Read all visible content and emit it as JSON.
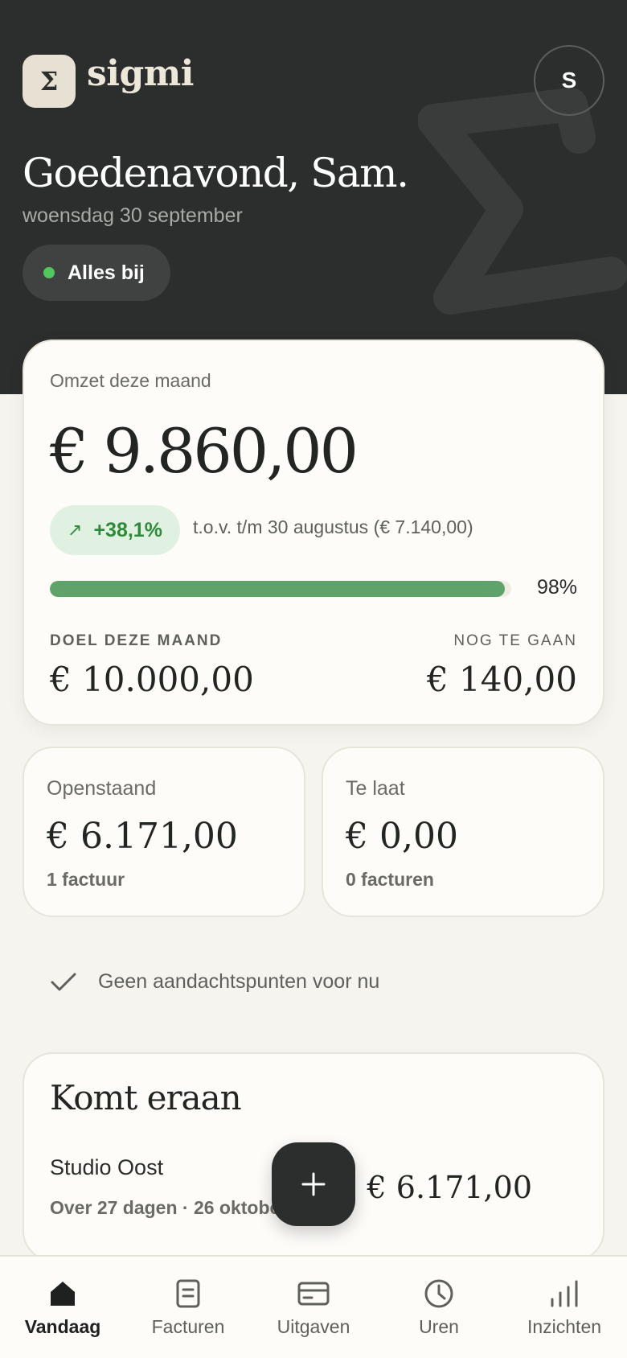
{
  "header": {
    "logo_symbol": "Σ",
    "brand": "sigmi",
    "avatar_initial": "S",
    "greeting": "Goedenavond, Sam.",
    "date": "woensdag 30 september",
    "status": "Alles bij"
  },
  "revenue": {
    "label": "Omzet deze maand",
    "amount": "€ 9.860,00",
    "growth": "+38,1%",
    "comparison": "t.o.v. t/m 30 augustus (€ 7.140,00)",
    "progress_percent_label": "98%",
    "progress_fraction": 0.986,
    "goal_label": "DOEL DEZE MAAND",
    "goal_value": "€ 10.000,00",
    "remaining_label": "NOG TE GAAN",
    "remaining_value": "€ 140,00"
  },
  "outstanding": {
    "label": "Openstaand",
    "amount": "€ 6.171,00",
    "sub": "1 factuur"
  },
  "overdue": {
    "label": "Te laat",
    "amount": "€ 0,00",
    "sub": "0 facturen"
  },
  "notice": "Geen aandachtspunten voor nu",
  "upcoming": {
    "title": "Komt eraan",
    "client": "Studio Oost",
    "when": "Over 27 dagen · 26 oktober",
    "amount": "€ 6.171,00"
  },
  "nav": [
    {
      "label": "Vandaag",
      "icon": "home-icon",
      "active": true
    },
    {
      "label": "Facturen",
      "icon": "document-icon"
    },
    {
      "label": "Uitgaven",
      "icon": "card-icon"
    },
    {
      "label": "Uren",
      "icon": "clock-icon"
    },
    {
      "label": "Inzichten",
      "icon": "bars-icon"
    }
  ],
  "colors": {
    "header_bg": "#2b2e2d",
    "page_bg": "#f6f4ee",
    "accent_green": "#5fa36b",
    "status_green": "#52c65f"
  }
}
